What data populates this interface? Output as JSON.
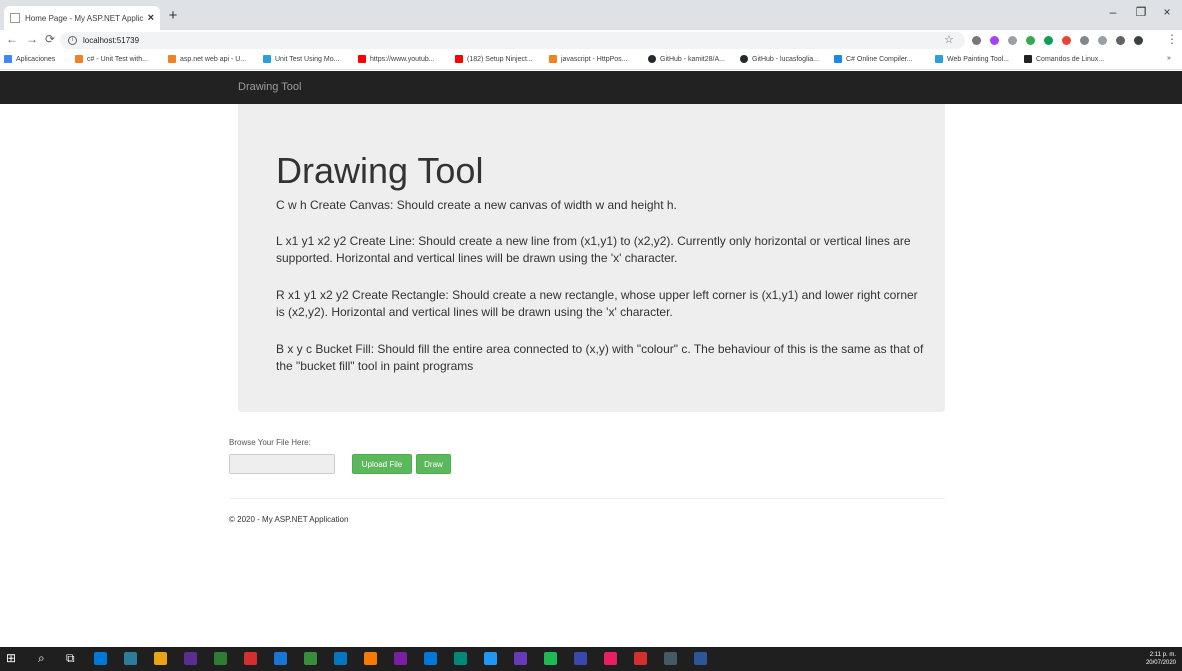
{
  "browser": {
    "tab_title": "Home Page - My ASP.NET Applic",
    "tab_close": "×",
    "new_tab": "+",
    "address": "localhost:51739",
    "window_controls": {
      "minimize": "–",
      "restore": "❐",
      "close": "×"
    },
    "bookmarks": [
      {
        "label": "Aplicaciones",
        "icon_color": "#4285f4"
      },
      {
        "label": "c# - Unit Test with...",
        "icon_color": "#f48024"
      },
      {
        "label": "asp.net web api - U...",
        "icon_color": "#f48024"
      },
      {
        "label": "Unit Test Using Mo...",
        "icon_color": "#2aa1d8"
      },
      {
        "label": "https://www.youtub...",
        "icon_color": "#ff0000"
      },
      {
        "label": "(182) Setup Ninject...",
        "icon_color": "#ff0000"
      },
      {
        "label": "javascript - HttpPos...",
        "icon_color": "#f48024"
      },
      {
        "label": "GitHub - kamit28/A...",
        "icon_color": "#24292e"
      },
      {
        "label": "GitHub - lucasfoglia...",
        "icon_color": "#24292e"
      },
      {
        "label": "C# Online Compiler...",
        "icon_color": "#1e88e5"
      },
      {
        "label": "Web Painting Tool...",
        "icon_color": "#2aa1d8"
      },
      {
        "label": "Comandos de Linux...",
        "icon_color": "#222222"
      }
    ],
    "bookmarks_overflow": "»"
  },
  "page": {
    "navbar_brand": "Drawing Tool",
    "jumbotron": {
      "title": "Drawing Tool",
      "paragraphs": [
        "C w h Create Canvas: Should create a new canvas of width w and height h.",
        "L x1 y1 x2 y2 Create Line: Should create a new line from (x1,y1) to (x2,y2). Currently only horizontal or vertical lines are supported. Horizontal and vertical lines will be drawn using the 'x' character.",
        "R x1 y1 x2 y2 Create Rectangle: Should create a new rectangle, whose upper left corner is (x1,y1) and lower right corner is (x2,y2). Horizontal and vertical lines will be drawn using the 'x' character.",
        "B x y c Bucket Fill: Should fill the entire area connected to (x,y) with \"colour\" c. The behaviour of this is the same as that of the \"bucket fill\" tool in paint programs"
      ]
    },
    "upload": {
      "label": "Browse Your File Here:",
      "upload_button": "Upload File",
      "draw_button": "Draw"
    },
    "footer": "© 2020 - My ASP.NET Application"
  },
  "taskbar": {
    "time": "2:11 p. m.",
    "date": "20/07/2020",
    "app_colors": [
      "#0078d7",
      "#2d7d9a",
      "#e8a317",
      "#5c2d91",
      "#2e7d32",
      "#d32f2f",
      "#1976d2",
      "#388e3c",
      "#0277bd",
      "#f57c00",
      "#7b1fa2",
      "#0078d7",
      "#00897b",
      "#2196f3",
      "#673ab7",
      "#1db954",
      "#3949ab",
      "#e91e63",
      "#d32f2f",
      "#455a64",
      "#2b579a"
    ]
  },
  "colors": {
    "navbar": "#222222",
    "jumbotron": "#eeeeee",
    "success": "#5cb85c"
  }
}
